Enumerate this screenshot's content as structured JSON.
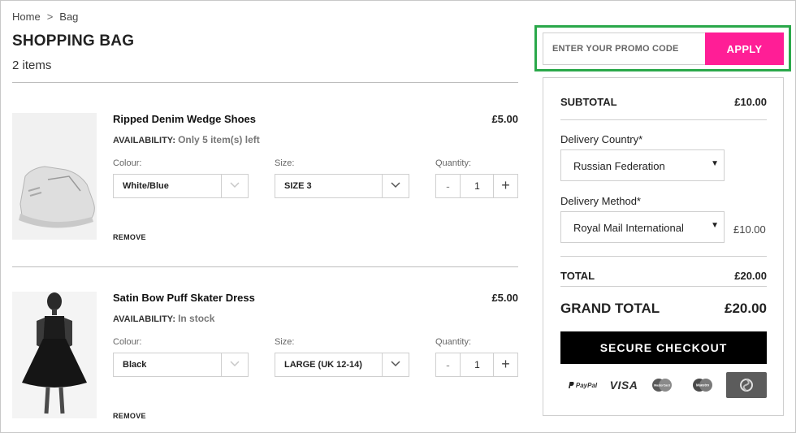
{
  "breadcrumb": {
    "home": "Home",
    "separator": ">",
    "current": "Bag"
  },
  "page": {
    "title": "SHOPPING BAG",
    "items_count": "2 items"
  },
  "labels": {
    "colour": "Colour:",
    "size": "Size:",
    "quantity": "Quantity:",
    "availability": "AVAILABILITY:",
    "remove": "REMOVE",
    "minus": "-",
    "plus": "+"
  },
  "products": [
    {
      "name": "Ripped Denim Wedge Shoes",
      "price": "£5.00",
      "availability": "Only 5 item(s) left",
      "colour": "White/Blue",
      "size": "SIZE 3",
      "quantity": "1"
    },
    {
      "name": "Satin Bow Puff Skater Dress",
      "price": "£5.00",
      "availability": "In stock",
      "colour": "Black",
      "size": "LARGE (UK 12-14)",
      "quantity": "1"
    }
  ],
  "promo": {
    "placeholder": "ENTER YOUR PROMO CODE",
    "apply_label": "APPLY",
    "highlight_color": "#2aa84a",
    "button_color": "#ff1e96"
  },
  "summary": {
    "subtotal_label": "SUBTOTAL",
    "subtotal_value": "£10.00",
    "delivery_country_label": "Delivery Country*",
    "delivery_country_value": "Russian Federation",
    "delivery_method_label": "Delivery Method*",
    "delivery_method_value": "Royal Mail International",
    "delivery_price": "£10.00",
    "total_label": "TOTAL",
    "total_value": "£20.00",
    "grand_total_label": "GRAND TOTAL",
    "grand_total_value": "£20.00",
    "checkout_label": "SECURE CHECKOUT"
  },
  "payments": {
    "paypal": "PayPal",
    "visa": "VISA",
    "mastercard": "MasterCard",
    "maestro": "Maestro",
    "icons": [
      "paypal-icon",
      "visa-icon",
      "mastercard-icon",
      "maestro-icon",
      "secure-icon"
    ]
  }
}
